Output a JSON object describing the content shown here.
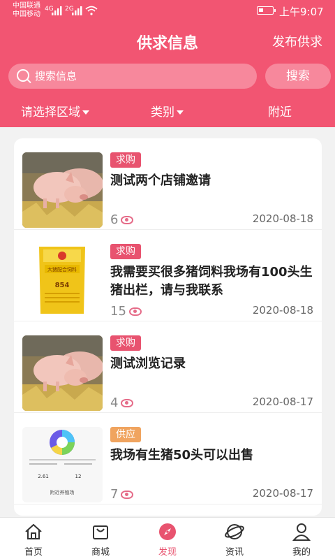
{
  "status": {
    "carrier1": "中国联通",
    "carrier2": "中国移动",
    "net1": "4G",
    "net2": "2G",
    "time": "上午9:07"
  },
  "header": {
    "title": "供求信息",
    "publish_label": "发布供求",
    "search_placeholder": "搜索信息",
    "search_button": "搜索",
    "filters": [
      "请选择区域",
      "类别",
      "附近"
    ]
  },
  "colors": {
    "brand": "#f25572",
    "tag_buy": "#e8536f",
    "tag_supply": "#f0a45f"
  },
  "items": [
    {
      "tag": "求购",
      "title": "测试两个店铺邀请",
      "views": "6",
      "date": "2020-08-18",
      "image": "pig-photo"
    },
    {
      "tag": "求购",
      "title": "我需要买很多猪饲料我场有100头生猪出栏，请与我联系",
      "views": "15",
      "date": "2020-08-18",
      "image": "feed-bag",
      "bag_text": "大猪配合饲料",
      "bag_code": "854"
    },
    {
      "tag": "求购",
      "title": "测试浏览记录",
      "views": "4",
      "date": "2020-08-17",
      "image": "pig-photo"
    },
    {
      "tag": "供应",
      "title": "我场有生猪50头可以出售",
      "views": "7",
      "date": "2020-08-17",
      "image": "app-screenshot",
      "shot_value1": "2.61",
      "shot_value2": "12",
      "shot_footer": "附近养殖场"
    }
  ],
  "tabs": [
    {
      "label": "首页",
      "icon": "home-icon",
      "active": false
    },
    {
      "label": "商城",
      "icon": "shop-icon",
      "active": false
    },
    {
      "label": "发现",
      "icon": "discover-icon",
      "active": true
    },
    {
      "label": "资讯",
      "icon": "news-icon",
      "active": false
    },
    {
      "label": "我的",
      "icon": "profile-icon",
      "active": false
    }
  ]
}
